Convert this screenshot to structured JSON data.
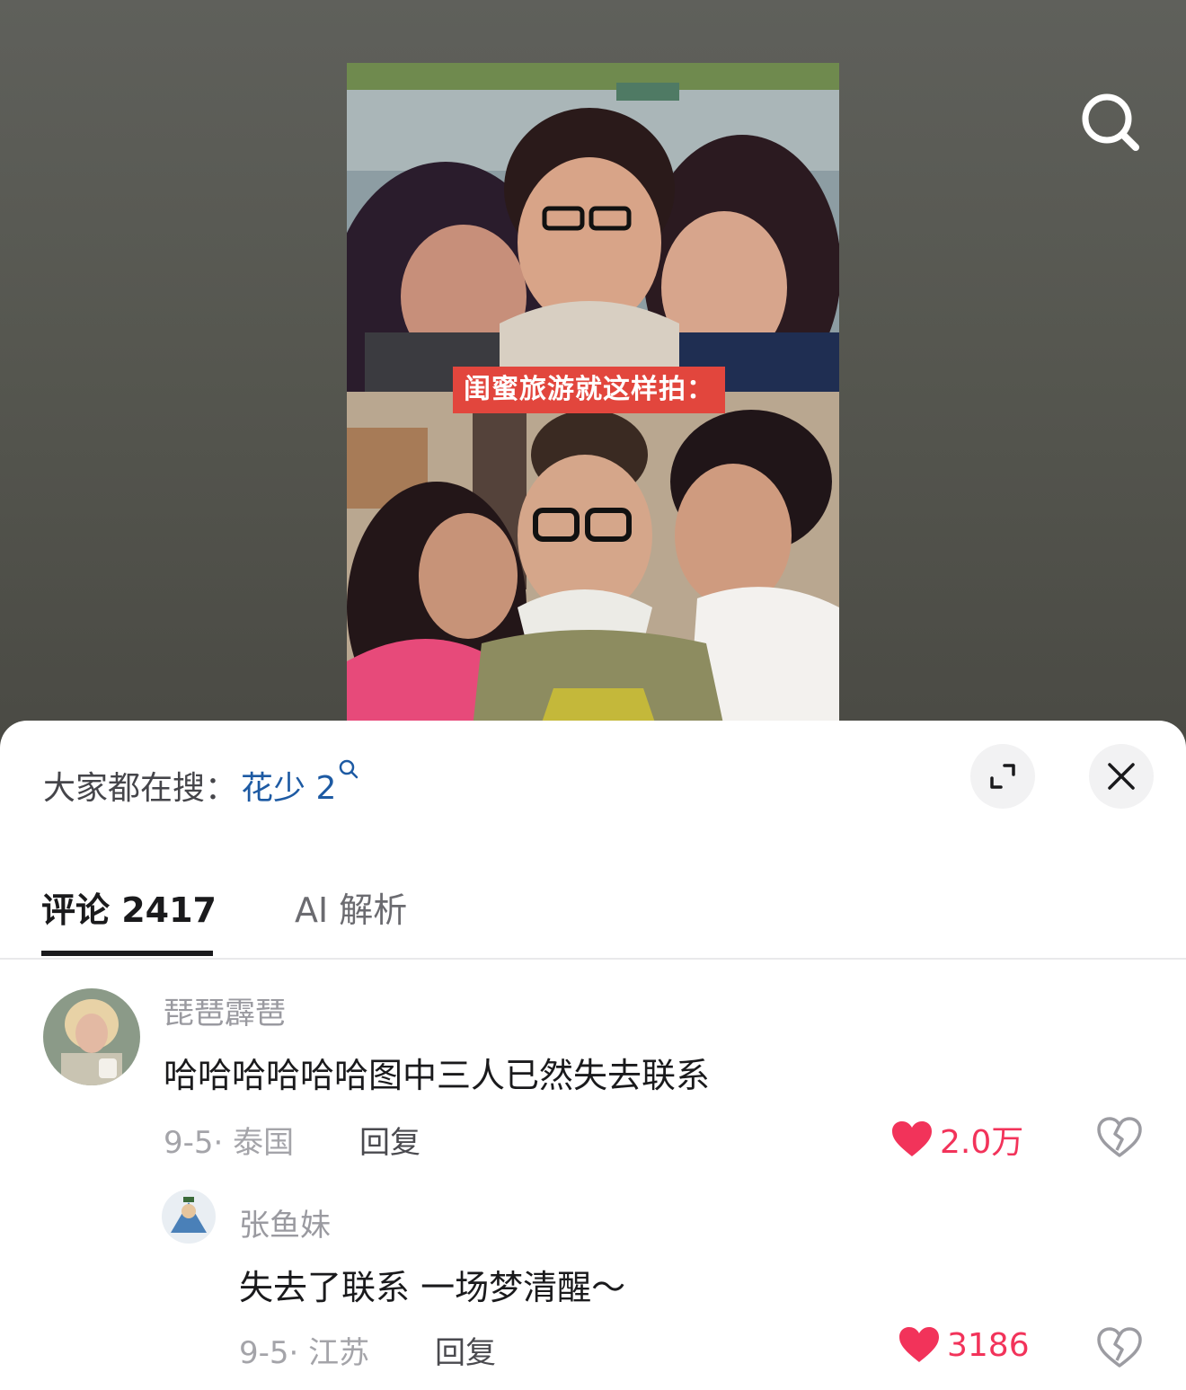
{
  "video": {
    "caption": "闺蜜旅游就这样拍："
  },
  "hot_search": {
    "prefix": "大家都在搜：",
    "term": "花少 2"
  },
  "tabs": [
    {
      "label": "评论 2417"
    },
    {
      "label": "AI 解析"
    }
  ],
  "comments": [
    {
      "user": "琵琶霹琶",
      "text": "哈哈哈哈哈哈图中三人已然失去联系",
      "meta": "9-5· 泰国",
      "reply_label": "回复",
      "likes": "2.0万"
    },
    {
      "user": "张鱼妹",
      "text": "失去了联系 一场梦清醒～",
      "meta": "9-5· 江苏",
      "reply_label": "回复",
      "likes": "3186"
    }
  ],
  "colors": {
    "accent_like": "#f2335a",
    "hot_link": "#1d5aa3",
    "caption_bg": "#e2463d"
  },
  "icons": [
    "search-icon",
    "expand-icon",
    "close-icon",
    "heart-icon",
    "broken-heart-icon"
  ]
}
